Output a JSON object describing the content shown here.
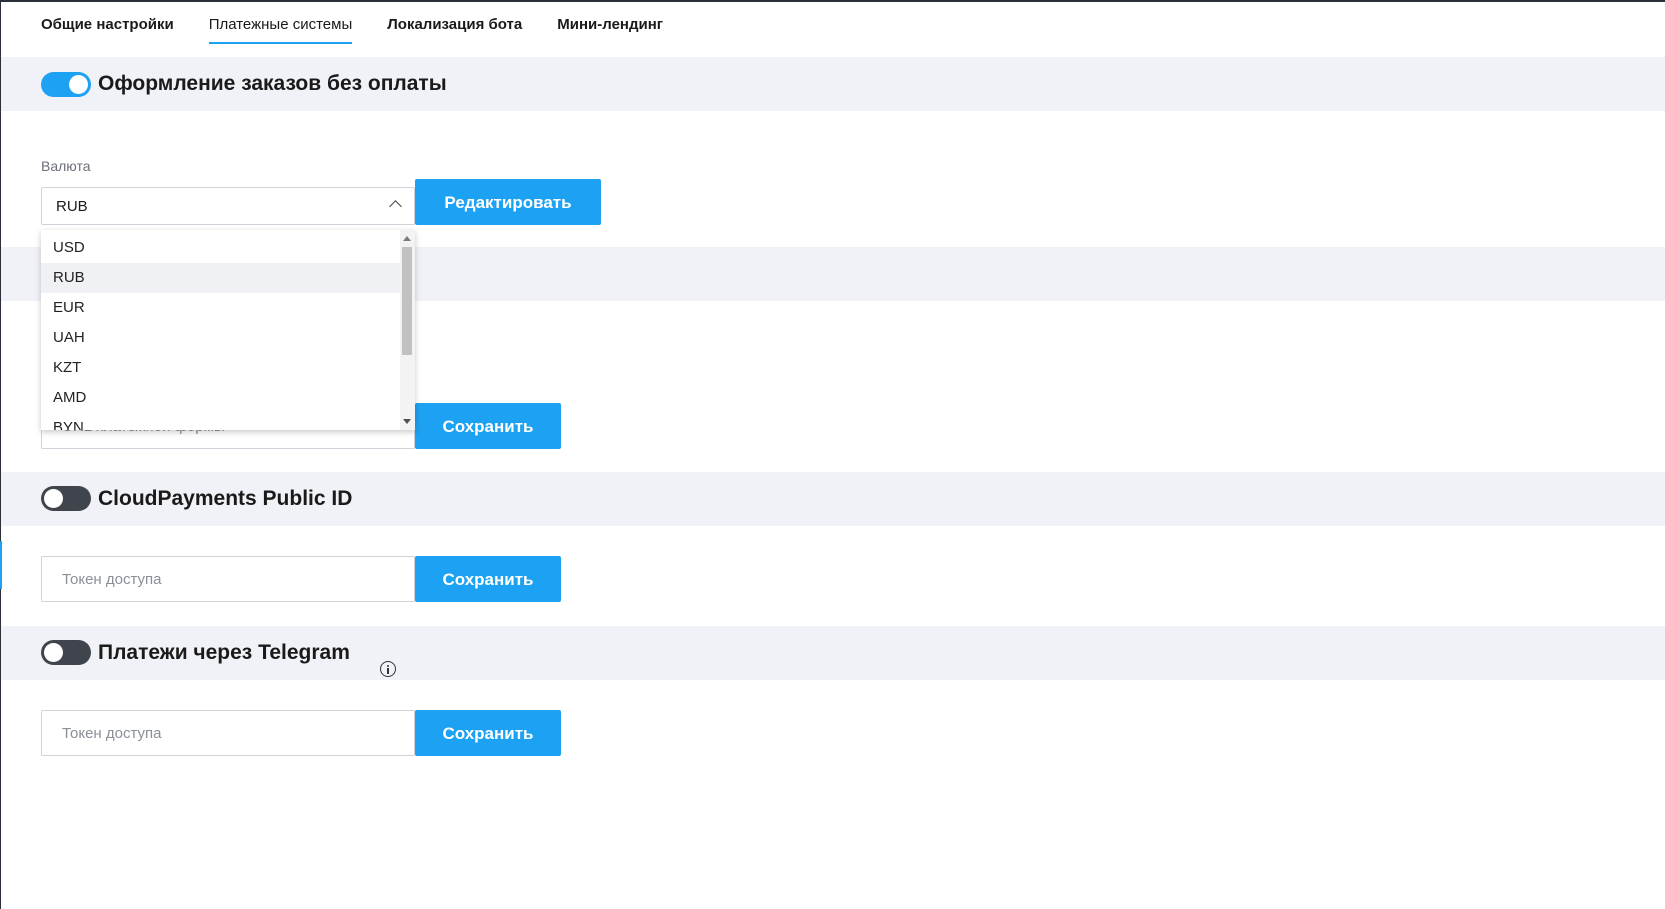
{
  "tabs": [
    {
      "label": "Общие настройки",
      "active": false
    },
    {
      "label": "Платежные системы",
      "active": true
    },
    {
      "label": "Локализация бота",
      "active": false
    },
    {
      "label": "Мини-лендинг",
      "active": false
    }
  ],
  "sections": {
    "no_payment": {
      "title": "Оформление заказов без оплаты",
      "enabled": true
    },
    "cloudpayments": {
      "title": "CloudPayments Public ID",
      "enabled": false
    },
    "telegram": {
      "title": "Платежи через Telegram",
      "enabled": false
    }
  },
  "currency": {
    "label": "Валюта",
    "selected": "RUB",
    "options": [
      "USD",
      "RUB",
      "EUR",
      "UAH",
      "KZT",
      "AMD",
      "BYN"
    ],
    "edit_label": "Редактировать"
  },
  "payment_form": {
    "placeholder": "URL платежной формы",
    "save_label": "Сохранить"
  },
  "cloudpayments_form": {
    "placeholder": "Токен доступа",
    "save_label": "Сохранить"
  },
  "telegram_form": {
    "placeholder": "Токен доступа",
    "save_label": "Сохранить"
  },
  "colors": {
    "accent": "#1da1f2",
    "band": "#f0f2f7",
    "toggle_off": "#3f444d"
  }
}
